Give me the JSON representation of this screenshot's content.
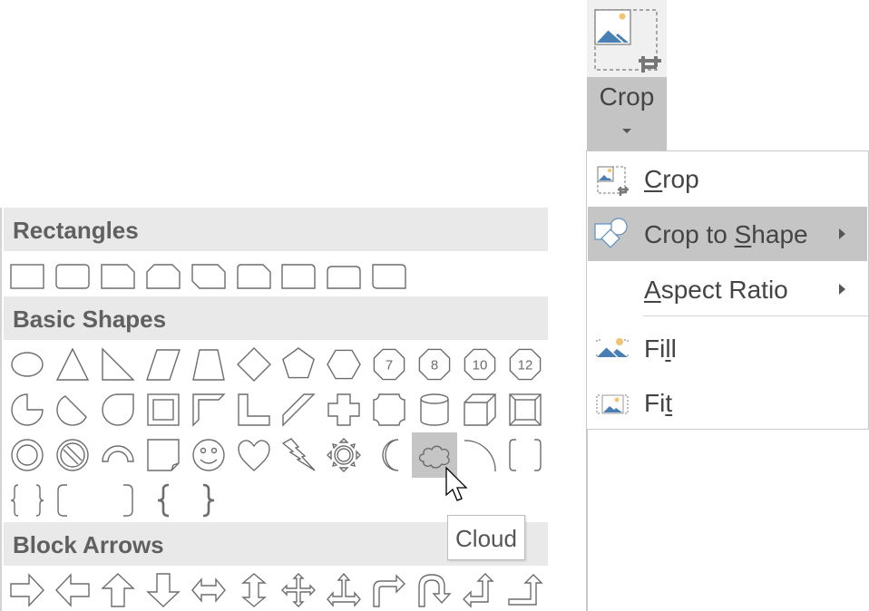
{
  "ribbon": {
    "crop_button": {
      "label": "Crop",
      "icon": "crop-icon",
      "has_dropdown": true
    }
  },
  "crop_menu": {
    "items": [
      {
        "label_pre": "",
        "mnemonic": "C",
        "label_post": "rop",
        "icon": "crop-icon",
        "submenu": false,
        "highlighted": false
      },
      {
        "label_pre": "Crop to ",
        "mnemonic": "S",
        "label_post": "hape",
        "icon": "crop-to-shape-icon",
        "submenu": true,
        "highlighted": true
      },
      {
        "label_pre": "",
        "mnemonic": "A",
        "label_post": "spect Ratio",
        "icon": "",
        "submenu": true,
        "highlighted": false
      },
      {
        "label_pre": "Fi",
        "mnemonic": "l",
        "label_post": "l",
        "icon": "fill-icon",
        "submenu": false,
        "highlighted": false
      },
      {
        "label_pre": "Fi",
        "mnemonic": "t",
        "label_post": "",
        "icon": "fit-icon",
        "submenu": false,
        "highlighted": false
      }
    ]
  },
  "shape_gallery": {
    "sections": [
      {
        "title": "Rectangles",
        "shapes": [
          "rectangle",
          "rounded-rectangle",
          "snip-single-corner-rectangle",
          "snip-same-side-corner-rectangle",
          "snip-diagonal-corner-rectangle",
          "snip-and-round-single-corner-rectangle",
          "round-single-corner-rectangle",
          "round-same-side-corner-rectangle",
          "round-diagonal-corner-rectangle"
        ]
      },
      {
        "title": "Basic Shapes",
        "shapes": [
          "oval",
          "isosceles-triangle",
          "right-triangle",
          "parallelogram",
          "trapezoid",
          "diamond",
          "regular-pentagon",
          "hexagon",
          "heptagon",
          "octagon",
          "decagon",
          "dodecagon",
          "pie",
          "chord",
          "teardrop",
          "frame",
          "half-frame",
          "l-shape",
          "diagonal-stripe",
          "cross",
          "plaque",
          "can",
          "cube",
          "bevel",
          "donut",
          "no-symbol",
          "block-arc",
          "folded-corner",
          "smiley-face",
          "heart",
          "lightning-bolt",
          "sun",
          "moon",
          "cloud",
          "arc",
          "double-bracket",
          "double-brace",
          "left-bracket",
          "right-bracket",
          "left-brace",
          "right-brace"
        ]
      },
      {
        "title": "Block Arrows",
        "shapes": [
          "right-arrow",
          "left-arrow",
          "up-arrow",
          "down-arrow",
          "left-right-arrow",
          "up-down-arrow",
          "quad-arrow",
          "left-right-up-arrow",
          "bent-arrow",
          "u-turn-arrow",
          "left-up-arrow",
          "bent-up-arrow"
        ]
      }
    ],
    "polygon_labels": {
      "heptagon": "7",
      "octagon": "8",
      "decagon": "10",
      "dodecagon": "12"
    },
    "hovered_shape": "cloud",
    "tooltip": "Cloud"
  },
  "colors": {
    "highlight": "#c5c5c5",
    "header_bg": "#e9e9e9",
    "icon_blue": "#4a7fb5",
    "icon_sun": "#f0c470"
  }
}
